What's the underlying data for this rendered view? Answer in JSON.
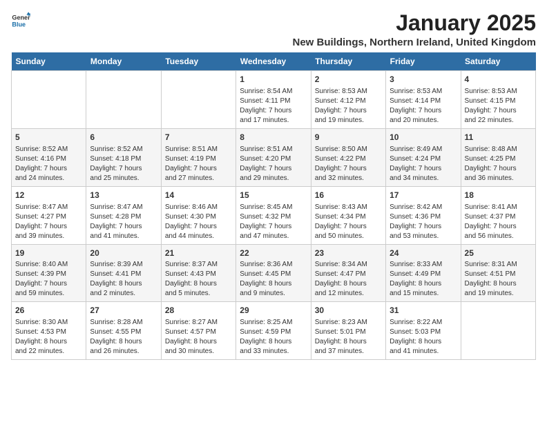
{
  "header": {
    "logo_general": "General",
    "logo_blue": "Blue",
    "month": "January 2025",
    "location": "New Buildings, Northern Ireland, United Kingdom"
  },
  "weekdays": [
    "Sunday",
    "Monday",
    "Tuesday",
    "Wednesday",
    "Thursday",
    "Friday",
    "Saturday"
  ],
  "weeks": [
    [
      {
        "day": "",
        "content": ""
      },
      {
        "day": "",
        "content": ""
      },
      {
        "day": "",
        "content": ""
      },
      {
        "day": "1",
        "content": "Sunrise: 8:54 AM\nSunset: 4:11 PM\nDaylight: 7 hours\nand 17 minutes."
      },
      {
        "day": "2",
        "content": "Sunrise: 8:53 AM\nSunset: 4:12 PM\nDaylight: 7 hours\nand 19 minutes."
      },
      {
        "day": "3",
        "content": "Sunrise: 8:53 AM\nSunset: 4:14 PM\nDaylight: 7 hours\nand 20 minutes."
      },
      {
        "day": "4",
        "content": "Sunrise: 8:53 AM\nSunset: 4:15 PM\nDaylight: 7 hours\nand 22 minutes."
      }
    ],
    [
      {
        "day": "5",
        "content": "Sunrise: 8:52 AM\nSunset: 4:16 PM\nDaylight: 7 hours\nand 24 minutes."
      },
      {
        "day": "6",
        "content": "Sunrise: 8:52 AM\nSunset: 4:18 PM\nDaylight: 7 hours\nand 25 minutes."
      },
      {
        "day": "7",
        "content": "Sunrise: 8:51 AM\nSunset: 4:19 PM\nDaylight: 7 hours\nand 27 minutes."
      },
      {
        "day": "8",
        "content": "Sunrise: 8:51 AM\nSunset: 4:20 PM\nDaylight: 7 hours\nand 29 minutes."
      },
      {
        "day": "9",
        "content": "Sunrise: 8:50 AM\nSunset: 4:22 PM\nDaylight: 7 hours\nand 32 minutes."
      },
      {
        "day": "10",
        "content": "Sunrise: 8:49 AM\nSunset: 4:24 PM\nDaylight: 7 hours\nand 34 minutes."
      },
      {
        "day": "11",
        "content": "Sunrise: 8:48 AM\nSunset: 4:25 PM\nDaylight: 7 hours\nand 36 minutes."
      }
    ],
    [
      {
        "day": "12",
        "content": "Sunrise: 8:47 AM\nSunset: 4:27 PM\nDaylight: 7 hours\nand 39 minutes."
      },
      {
        "day": "13",
        "content": "Sunrise: 8:47 AM\nSunset: 4:28 PM\nDaylight: 7 hours\nand 41 minutes."
      },
      {
        "day": "14",
        "content": "Sunrise: 8:46 AM\nSunset: 4:30 PM\nDaylight: 7 hours\nand 44 minutes."
      },
      {
        "day": "15",
        "content": "Sunrise: 8:45 AM\nSunset: 4:32 PM\nDaylight: 7 hours\nand 47 minutes."
      },
      {
        "day": "16",
        "content": "Sunrise: 8:43 AM\nSunset: 4:34 PM\nDaylight: 7 hours\nand 50 minutes."
      },
      {
        "day": "17",
        "content": "Sunrise: 8:42 AM\nSunset: 4:36 PM\nDaylight: 7 hours\nand 53 minutes."
      },
      {
        "day": "18",
        "content": "Sunrise: 8:41 AM\nSunset: 4:37 PM\nDaylight: 7 hours\nand 56 minutes."
      }
    ],
    [
      {
        "day": "19",
        "content": "Sunrise: 8:40 AM\nSunset: 4:39 PM\nDaylight: 7 hours\nand 59 minutes."
      },
      {
        "day": "20",
        "content": "Sunrise: 8:39 AM\nSunset: 4:41 PM\nDaylight: 8 hours\nand 2 minutes."
      },
      {
        "day": "21",
        "content": "Sunrise: 8:37 AM\nSunset: 4:43 PM\nDaylight: 8 hours\nand 5 minutes."
      },
      {
        "day": "22",
        "content": "Sunrise: 8:36 AM\nSunset: 4:45 PM\nDaylight: 8 hours\nand 9 minutes."
      },
      {
        "day": "23",
        "content": "Sunrise: 8:34 AM\nSunset: 4:47 PM\nDaylight: 8 hours\nand 12 minutes."
      },
      {
        "day": "24",
        "content": "Sunrise: 8:33 AM\nSunset: 4:49 PM\nDaylight: 8 hours\nand 15 minutes."
      },
      {
        "day": "25",
        "content": "Sunrise: 8:31 AM\nSunset: 4:51 PM\nDaylight: 8 hours\nand 19 minutes."
      }
    ],
    [
      {
        "day": "26",
        "content": "Sunrise: 8:30 AM\nSunset: 4:53 PM\nDaylight: 8 hours\nand 22 minutes."
      },
      {
        "day": "27",
        "content": "Sunrise: 8:28 AM\nSunset: 4:55 PM\nDaylight: 8 hours\nand 26 minutes."
      },
      {
        "day": "28",
        "content": "Sunrise: 8:27 AM\nSunset: 4:57 PM\nDaylight: 8 hours\nand 30 minutes."
      },
      {
        "day": "29",
        "content": "Sunrise: 8:25 AM\nSunset: 4:59 PM\nDaylight: 8 hours\nand 33 minutes."
      },
      {
        "day": "30",
        "content": "Sunrise: 8:23 AM\nSunset: 5:01 PM\nDaylight: 8 hours\nand 37 minutes."
      },
      {
        "day": "31",
        "content": "Sunrise: 8:22 AM\nSunset: 5:03 PM\nDaylight: 8 hours\nand 41 minutes."
      },
      {
        "day": "",
        "content": ""
      }
    ]
  ]
}
